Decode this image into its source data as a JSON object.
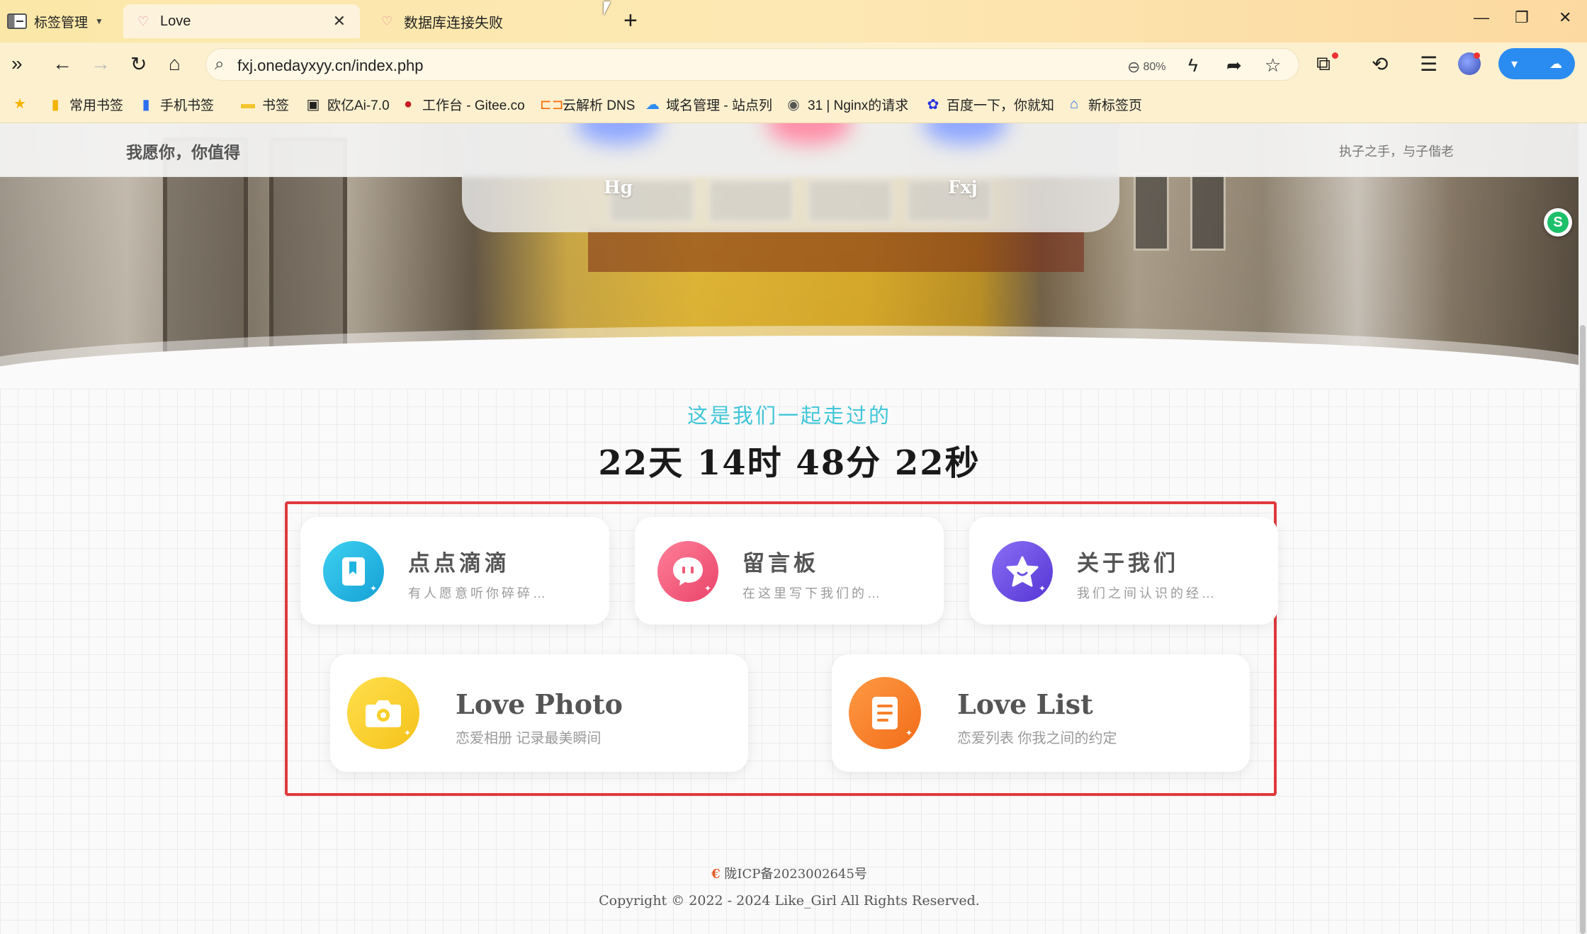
{
  "browser": {
    "tab_manager_label": "标签管理",
    "tabs": [
      {
        "title": "Love",
        "active": true
      },
      {
        "title": "数据库连接失败",
        "active": false
      }
    ],
    "url": "fxj.onedayxyy.cn/index.php",
    "zoom": "80%",
    "bookmarks": [
      {
        "label": "常用书签",
        "icon": "bookmark-icon"
      },
      {
        "label": "手机书签",
        "icon": "phone-icon"
      },
      {
        "label": "书签",
        "icon": "folder-icon"
      },
      {
        "label": "欧亿Ai-7.0",
        "icon": "ai-icon"
      },
      {
        "label": "工作台 - Gitee.co",
        "icon": "gitee-icon"
      },
      {
        "label": "云解析 DNS",
        "icon": "dns-icon"
      },
      {
        "label": "域名管理 - 站点列",
        "icon": "cloud-icon"
      },
      {
        "label": "31 | Nginx的请求",
        "icon": "globe-icon"
      },
      {
        "label": "百度一下，你就知",
        "icon": "baidu-icon"
      },
      {
        "label": "新标签页",
        "icon": "home-icon"
      }
    ]
  },
  "page": {
    "brand": "我愿你，你值得",
    "motto": "执子之手，与子偕老",
    "names": {
      "left": "Hg",
      "right": "Fxj"
    },
    "subtitle": "这是我们一起走过的",
    "counter": "22天 14时 48分 22秒",
    "cards_top": [
      {
        "title": "点点滴滴",
        "desc": "有人愿意听你碎碎…",
        "color": "#1fb3df"
      },
      {
        "title": "留言板",
        "desc": "在这里写下我们的…",
        "color": "#f05a78"
      },
      {
        "title": "关于我们",
        "desc": "我们之间认识的经…",
        "color": "#6a4ee0"
      }
    ],
    "cards_bottom": [
      {
        "title": "Love Photo",
        "desc": "恋爱相册 记录最美瞬间",
        "color": "#f8cf2a"
      },
      {
        "title": "Love List",
        "desc": "恋爱列表 你我之间的约定",
        "color": "#f7812a"
      }
    ],
    "footer": {
      "icp": "陇ICP备2023002645号",
      "copyright": "Copyright © 2022 - 2024 Like_Girl All Rights Reserved."
    }
  }
}
